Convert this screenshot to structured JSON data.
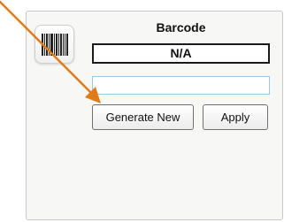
{
  "panel": {
    "title": "Barcode",
    "value": "N/A",
    "input_value": "",
    "input_placeholder": ""
  },
  "buttons": {
    "generate_label": "Generate New",
    "apply_label": "Apply"
  },
  "icons": {
    "barcode": "barcode-icon",
    "annotation_arrow": "arrow-pointer"
  },
  "colors": {
    "arrow": "#e07b17",
    "panel_background": "#f7f7f5",
    "input_border": "#9ec6dc"
  }
}
